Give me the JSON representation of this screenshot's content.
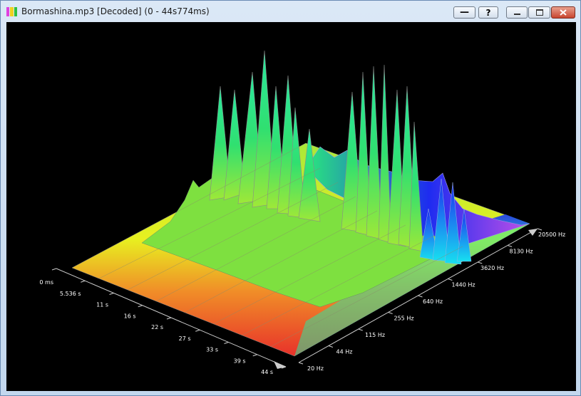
{
  "window": {
    "title": "Bormashina.mp3 [Decoded] (0 - 44s774ms)",
    "icon": "spectrum-bars-icon",
    "buttons": {
      "line_label": "—",
      "help_label": "?",
      "minimize": "minimize-icon",
      "maximize": "maximize-icon",
      "close": "close-icon"
    }
  },
  "plot": {
    "time_axis_labels": [
      "0 ms",
      "5.536 s",
      "11 s",
      "16 s",
      "22 s",
      "27 s",
      "33 s",
      "39 s",
      "44 s"
    ],
    "freq_axis_labels": [
      "20 Hz",
      "44 Hz",
      "115 Hz",
      "255 Hz",
      "640 Hz",
      "1440 Hz",
      "3620 Hz",
      "8130 Hz",
      "20500 Hz"
    ],
    "colors": {
      "background": "#000000",
      "low": "#e8322a",
      "mid": "#e8f020",
      "high_green": "#2ae87c",
      "cyan": "#18e0f0",
      "blue": "#1e2cf0",
      "violet": "#c050e8",
      "grid": "#888888"
    }
  }
}
